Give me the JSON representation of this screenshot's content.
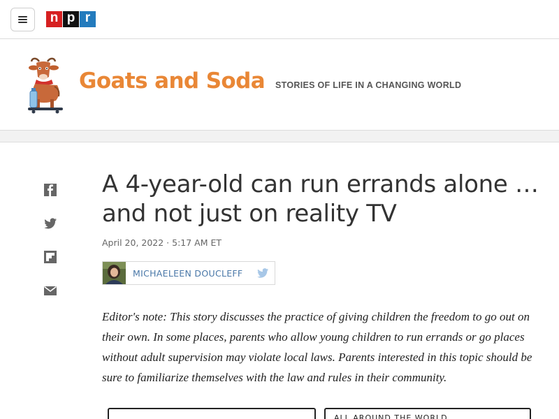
{
  "topbar": {
    "menu_icon": "hamburger-menu-icon",
    "logo": {
      "letters": [
        "n",
        "p",
        "r"
      ],
      "colors": [
        "#d62021",
        "#111111",
        "#237bbd"
      ]
    }
  },
  "blog": {
    "title": "Goats and Soda",
    "tagline": "STORIES OF LIFE IN A CHANGING WORLD",
    "title_color": "#e98736",
    "logo_icon": "goat-with-bottle-icon"
  },
  "share": {
    "icons": [
      "facebook-icon",
      "twitter-icon",
      "flipboard-icon",
      "email-icon"
    ],
    "icon_color": "#666666"
  },
  "article": {
    "headline": "A 4-year-old can run errands alone … and not just on reality TV",
    "dateline": "April 20, 2022 · 5:17 AM ET",
    "author": {
      "name": "MICHAELEEN DOUCLEFF",
      "social_icon": "twitter-icon"
    },
    "editors_note": "Editor's note: This story discusses the practice of giving children the freedom to go out on their own. In some places, parents who allow young children to run errands or go places without adult supervision may violate local laws. Parents interested in this topic should be sure to familiarize themselves with the law and rules in their community.",
    "illustration": {
      "right_caption": "ALL AROUND THE WORLD"
    }
  }
}
